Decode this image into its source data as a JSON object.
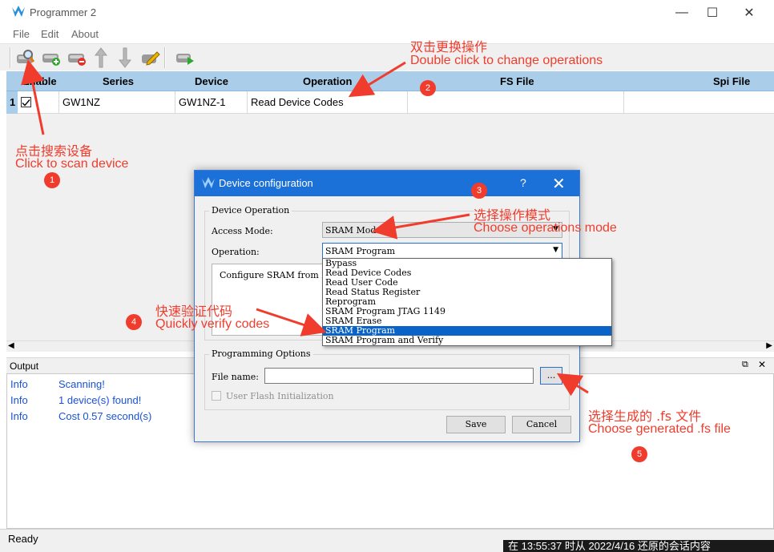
{
  "window": {
    "title": "Programmer 2",
    "minimize": "—",
    "maximize": "☐",
    "close": "✕"
  },
  "menu": {
    "items": [
      "File",
      "Edit",
      "About"
    ]
  },
  "table": {
    "columns": [
      "Enable",
      "Series",
      "Device",
      "Operation",
      "FS File",
      "Spi File"
    ],
    "row": {
      "index": "1",
      "enabled": true,
      "series": "GW1NZ",
      "device": "GW1NZ-1",
      "operation": "Read Device Codes",
      "fs_file": "",
      "spi_file": ""
    }
  },
  "output": {
    "header": "Output",
    "rows": [
      {
        "level": "Info",
        "message": "Scanning!"
      },
      {
        "level": "Info",
        "message": "1 device(s) found!"
      },
      {
        "level": "Info",
        "message": "Cost 0.57 second(s)"
      }
    ]
  },
  "status": {
    "text": "Ready"
  },
  "taskbar_text": "在 13:55:37 时从 2022/4/16 还原的会话内容",
  "dialog": {
    "title": "Device configuration",
    "help": "?",
    "close": "✕",
    "group_operation": "Device Operation",
    "access_mode_label": "Access Mode:",
    "access_mode_value": "SRAM Mode",
    "operation_label": "Operation:",
    "operation_value": "SRAM Program",
    "description": "Configure SRAM from FS",
    "options": [
      "Bypass",
      "Read Device Codes",
      "Read User Code",
      "Read Status Register",
      "Reprogram",
      "SRAM Program JTAG 1149",
      "SRAM Erase",
      "SRAM Program",
      "SRAM Program and Verify"
    ],
    "selected_option": "SRAM Program",
    "group_programming": "Programming Options",
    "file_name_label": "File name:",
    "file_name_value": "",
    "browse": "...",
    "flash_init_label": "User Flash Initialization",
    "save": "Save",
    "cancel": "Cancel"
  },
  "annotations": {
    "a1_zh": "点击搜索设备",
    "a1_en": "Click to scan device",
    "b1": "1",
    "a2_zh": "双击更换操作",
    "a2_en": "Double click to change operations",
    "b2": "2",
    "a3_zh": "选择操作模式",
    "a3_en": "Choose operations mode",
    "b3": "3",
    "a4_zh": "快速验证代码",
    "a4_en": "Quickly verify codes",
    "b4": "4",
    "a5_zh": "选择生成的 .fs 文件",
    "a5_en": "Choose generated .fs file",
    "b5": "5",
    "color": "#f03c2c"
  }
}
